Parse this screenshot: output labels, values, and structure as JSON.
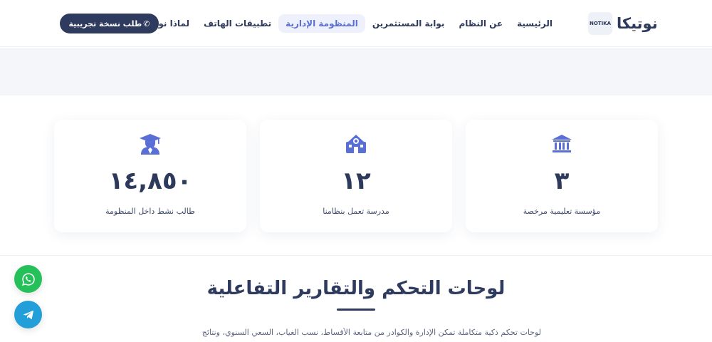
{
  "header": {
    "logo_badge": "NOTIKA",
    "logo_text": "نوتيكا",
    "nav": [
      {
        "label": "الرئيسية",
        "active": false
      },
      {
        "label": "عن النظام",
        "active": false
      },
      {
        "label": "بوابة المستثمرين",
        "active": false
      },
      {
        "label": "المنظومة الإدارية",
        "active": true
      },
      {
        "label": "تطبيقات الهاتف",
        "active": false
      },
      {
        "label": "لماذا نوتيكا؟",
        "active": false
      }
    ],
    "cta_label": "طلب نسخة تجريبية"
  },
  "stats": [
    {
      "value": "٣",
      "label": "مؤسسة تعليمية مرخصة",
      "icon": "institution-icon"
    },
    {
      "value": "١٢",
      "label": "مدرسة تعمل بنظامنا",
      "icon": "school-icon"
    },
    {
      "value": "١٤,٨٥٠",
      "label": "طالب نشط داخل المنظومة",
      "icon": "graduate-icon"
    }
  ],
  "section": {
    "title": "لوحات التحكم والتقارير التفاعلية",
    "description": "لوحات تحكم ذكية متكاملة تمكن الإدارة والكوادر من متابعة الأقساط، نسب الغياب، السعي السنوي، ونتائج"
  },
  "colors": {
    "primary": "#2f3b5e",
    "accent": "#5a6fd6",
    "whatsapp": "#25c05a",
    "telegram": "#229ed9"
  }
}
